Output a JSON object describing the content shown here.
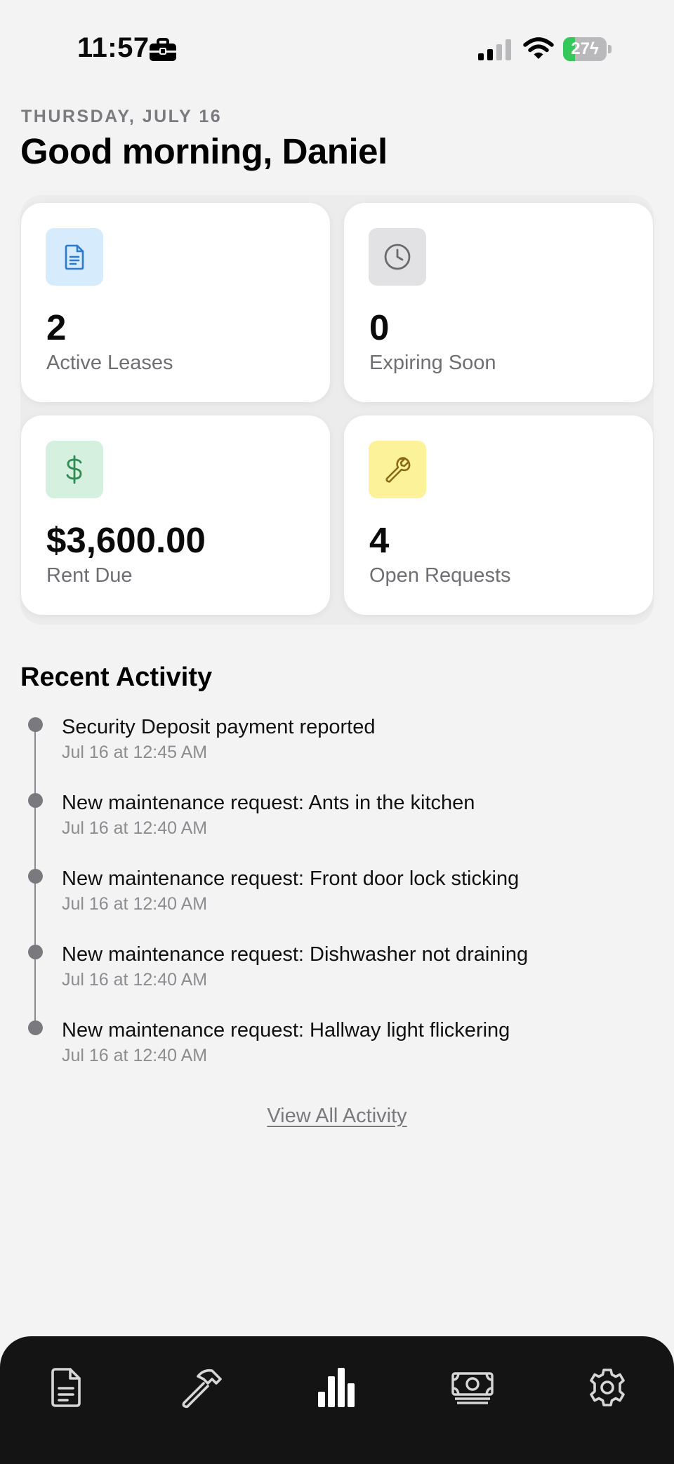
{
  "status_bar": {
    "time": "11:57",
    "battery_percent": 27,
    "battery_label": "27",
    "icons": [
      "briefcase-icon",
      "cellular-signal-icon",
      "wifi-icon",
      "battery-charging-icon"
    ]
  },
  "header": {
    "date": "THURSDAY, JULY 16",
    "greeting": "Good morning, Daniel"
  },
  "stats": [
    {
      "icon": "document-icon",
      "value": "2",
      "label": "Active Leases",
      "icon_bg": "#d6ebfb",
      "icon_color": "#2a7ad0"
    },
    {
      "icon": "clock-icon",
      "value": "0",
      "label": "Expiring Soon",
      "icon_bg": "#e2e2e4",
      "icon_color": "#6a6a6e"
    },
    {
      "icon": "dollar-icon",
      "value": "$3,600.00",
      "label": "Rent Due",
      "icon_bg": "#d5f0df",
      "icon_color": "#2f8a55"
    },
    {
      "icon": "wrench-icon",
      "value": "4",
      "label": "Open Requests",
      "icon_bg": "#fbf29a",
      "icon_color": "#8a6a12"
    }
  ],
  "recent_activity": {
    "title": "Recent Activity",
    "items": [
      {
        "title": "Security Deposit payment reported",
        "time": "Jul 16 at 12:45 AM"
      },
      {
        "title": "New maintenance request: Ants in the kitchen",
        "time": "Jul 16 at 12:40 AM"
      },
      {
        "title": "New maintenance request: Front door lock sticking",
        "time": "Jul 16 at 12:40 AM"
      },
      {
        "title": "New maintenance request: Dishwasher not draining",
        "time": "Jul 16 at 12:40 AM"
      },
      {
        "title": "New maintenance request: Hallway light flickering",
        "time": "Jul 16 at 12:40 AM"
      }
    ],
    "view_all_label": "View All Activity"
  },
  "tab_bar": {
    "tabs": [
      {
        "icon": "document-icon",
        "active": false
      },
      {
        "icon": "hammer-icon",
        "active": false
      },
      {
        "icon": "bar-chart-icon",
        "active": true
      },
      {
        "icon": "cash-icon",
        "active": false
      },
      {
        "icon": "gear-icon",
        "active": false
      }
    ]
  },
  "colors": {
    "background": "#f3f3f4",
    "tab_bar": "#141414",
    "battery_green": "#34c759"
  }
}
